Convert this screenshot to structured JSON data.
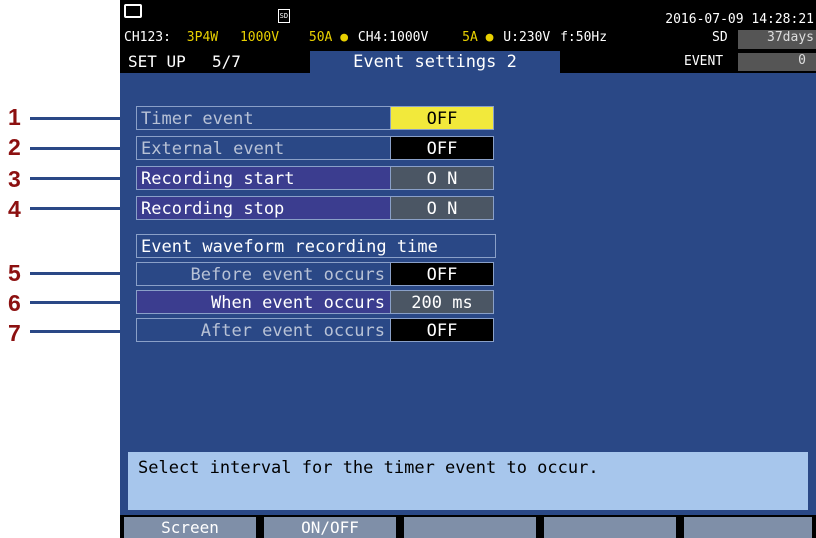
{
  "status": {
    "channel1": "CH123:",
    "wiring": "3P4W",
    "voltage1": "1000V",
    "current1": "50A",
    "channel4": "CH4:1000V",
    "current4": "5A",
    "u": "U:230V",
    "freq": "f:50Hz",
    "datetime": "2016-07-09 14:28:21",
    "sd_label": "SD",
    "sd_days": "37days",
    "event_label": "EVENT",
    "event_count": "0"
  },
  "header": {
    "mode": "SET UP",
    "page": "5/7",
    "title": "Event settings 2"
  },
  "settings": [
    {
      "label": "Timer event",
      "value": "OFF"
    },
    {
      "label": "External event",
      "value": "OFF"
    },
    {
      "label": "Recording start",
      "value": "O N"
    },
    {
      "label": "Recording stop",
      "value": "O N"
    }
  ],
  "waveform": {
    "title": "Event waveform recording time",
    "items": [
      {
        "label": "Before event occurs",
        "value": "OFF"
      },
      {
        "label": "When event occurs",
        "value": "200 ms"
      },
      {
        "label": "After event occurs",
        "value": "OFF"
      }
    ]
  },
  "help": "Select interval for the timer event to occur.",
  "function_keys": [
    "Screen",
    "ON/OFF",
    "",
    "",
    ""
  ],
  "callouts": [
    "1",
    "2",
    "3",
    "4",
    "5",
    "6",
    "7"
  ],
  "colors": {
    "screen_bg": "#2a4886",
    "highlight": "#f2e93b",
    "callout": "#8c1010",
    "help_bg": "#a7c6ec"
  }
}
